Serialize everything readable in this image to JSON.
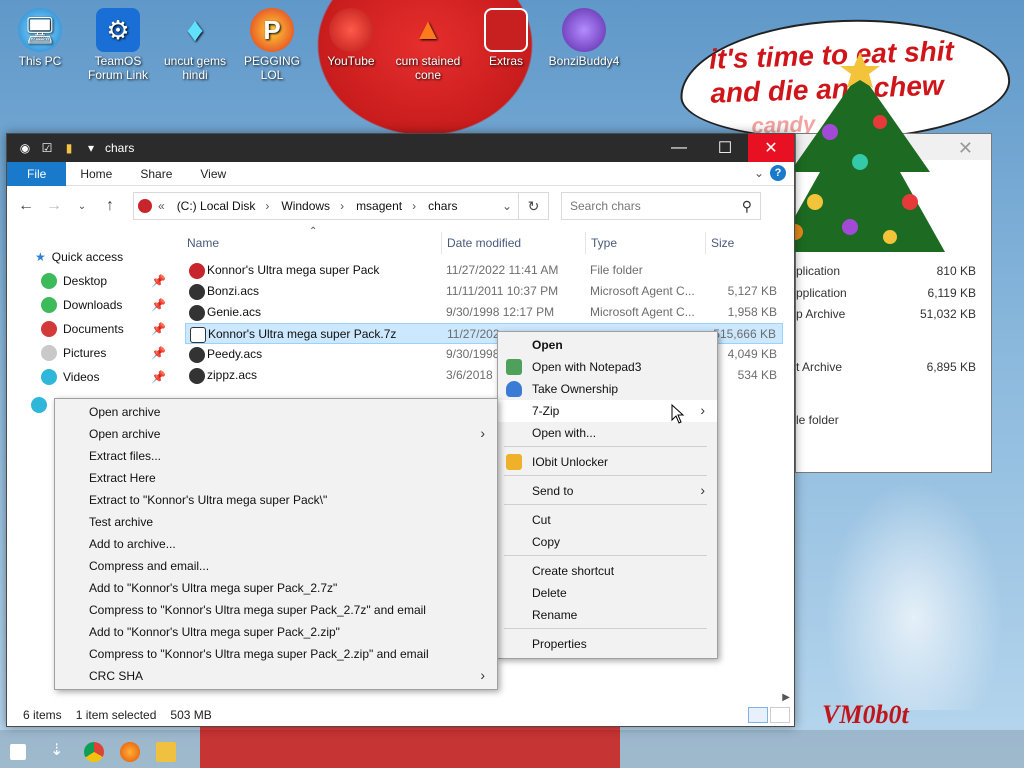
{
  "desktop": {
    "icons": [
      {
        "label": "This PC",
        "icon": "monitor-icon"
      },
      {
        "label": "TeamOS Forum Link",
        "icon": "gear-icon"
      },
      {
        "label": "uncut gems hindi",
        "icon": "diamond-icon"
      },
      {
        "label": "PEGGING LOL",
        "icon": "p-logo-icon"
      },
      {
        "label": "YouTube",
        "icon": "angry-bird-icon"
      },
      {
        "label": "cum stained cone",
        "icon": "traffic-cone-icon"
      },
      {
        "label": "Extras",
        "icon": "box-icon"
      },
      {
        "label": "BonziBuddy4",
        "icon": "purple-gorilla-icon"
      }
    ],
    "speech_bubble": "it's time to eat shit and die and chew",
    "speech_bubble_sub": "candy",
    "signature": "VM0b0t"
  },
  "window": {
    "title": "chars",
    "minimize": "—",
    "maximize": "☐",
    "close": "✕"
  },
  "ribbon": {
    "tabs": [
      "File",
      "Home",
      "Share",
      "View"
    ]
  },
  "address": {
    "prefix": "«",
    "segments": [
      "(C:) Local Disk",
      "Windows",
      "msagent",
      "chars"
    ],
    "separator": "›"
  },
  "search": {
    "placeholder": "Search chars"
  },
  "nav_pane": {
    "quick_access": "Quick access",
    "items": [
      "Desktop",
      "Downloads",
      "Documents",
      "Pictures",
      "Videos"
    ]
  },
  "columns": {
    "name": "Name",
    "date": "Date modified",
    "type": "Type",
    "size": "Size"
  },
  "files": [
    {
      "name": "Konnor's Ultra mega super Pack",
      "date": "11/27/2022 11:41 AM",
      "type": "File folder",
      "size": ""
    },
    {
      "name": "Bonzi.acs",
      "date": "11/11/2011 10:37 PM",
      "type": "Microsoft Agent C...",
      "size": "5,127 KB"
    },
    {
      "name": "Genie.acs",
      "date": "9/30/1998 12:17 PM",
      "type": "Microsoft Agent C...",
      "size": "1,958 KB"
    },
    {
      "name": "Konnor's Ultra mega super Pack.7z",
      "date": "11/27/202",
      "type": "",
      "size": "515,666 KB"
    },
    {
      "name": "Peedy.acs",
      "date": "9/30/1998",
      "type": "",
      "size": "4,049 KB"
    },
    {
      "name": "zippz.acs",
      "date": "3/6/2018",
      "type": "",
      "size": "534 KB"
    }
  ],
  "status": {
    "items": "6 items",
    "selected": "1 item selected",
    "size": "503 MB"
  },
  "back_window": {
    "rows": [
      {
        "left": "plication",
        "right": "810 KB"
      },
      {
        "left": "pplication",
        "right": "6,119 KB"
      },
      {
        "left": "p Archive",
        "right": "51,032 KB"
      },
      {
        "left": "t Archive",
        "right": "6,895 KB"
      },
      {
        "left": "le folder",
        "right": ""
      }
    ]
  },
  "context_menu": {
    "items": [
      "Open",
      "Open with Notepad3",
      "Take Ownership",
      "7-Zip",
      "Open with...",
      "IObit Unlocker",
      "Send to",
      "Cut",
      "Copy",
      "Create shortcut",
      "Delete",
      "Rename",
      "Properties"
    ]
  },
  "submenu_7zip": {
    "items": [
      "Open archive",
      "Open archive",
      "Extract files...",
      "Extract Here",
      "Extract to \"Konnor's Ultra mega super Pack\\\"",
      "Test archive",
      "Add to archive...",
      "Compress and email...",
      "Add to \"Konnor's Ultra mega super Pack_2.7z\"",
      "Compress to \"Konnor's Ultra mega super Pack_2.7z\" and email",
      "Add to \"Konnor's Ultra mega super Pack_2.zip\"",
      "Compress to \"Konnor's Ultra mega super Pack_2.zip\" and email",
      "CRC SHA"
    ]
  },
  "colors": {
    "accent": "#1979ca",
    "close_red": "#e81123",
    "titlebar": "#2b2b2b",
    "selection": "#cce8ff"
  }
}
